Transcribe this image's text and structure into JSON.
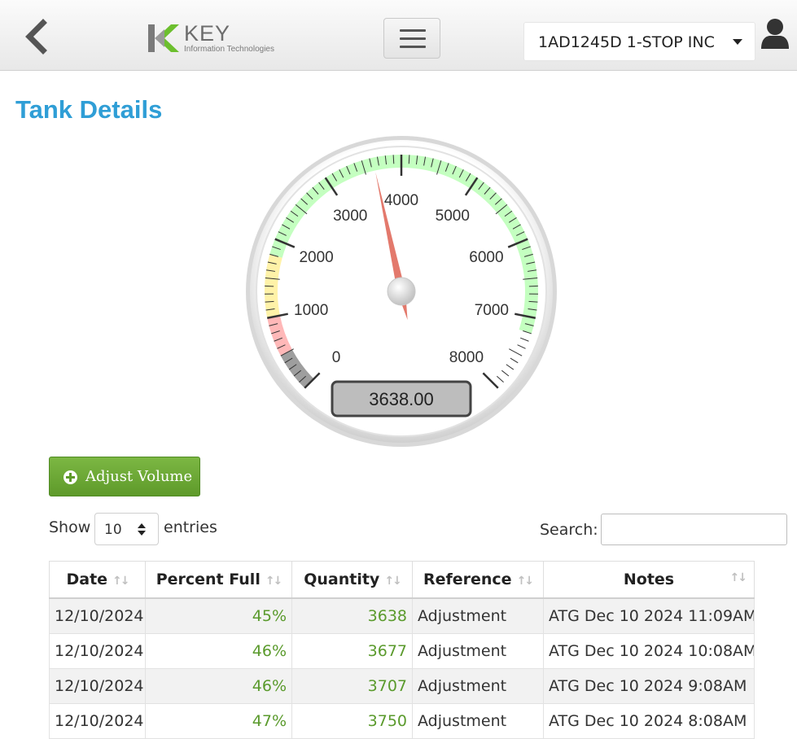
{
  "header": {
    "logo_text": "KEY",
    "logo_subtext": "Information Technologies",
    "site_selector": "1AD1245D 1-STOP INC",
    "back_icon": "chevron-left-icon",
    "menu_icon": "hamburger-icon",
    "user_icon": "user-icon"
  },
  "page": {
    "title": "Tank Details"
  },
  "gauge": {
    "min": 0,
    "max": 8000,
    "value": 3638,
    "display": "3638.00",
    "major_ticks": [
      "0",
      "1000",
      "2000",
      "3000",
      "4000",
      "5000",
      "6000",
      "7000",
      "8000"
    ],
    "bands": [
      {
        "from": 0,
        "to": 500,
        "color": "#9e9e9e"
      },
      {
        "from": 500,
        "to": 1000,
        "color": "#ffb8b8"
      },
      {
        "from": 1000,
        "to": 1800,
        "color": "#fff2a8"
      },
      {
        "from": 1800,
        "to": 7200,
        "color": "#c4ffc0"
      }
    ]
  },
  "actions": {
    "adjust_volume": "Adjust Volume",
    "adjust_icon": "plus-circle-icon"
  },
  "table_controls": {
    "show_label": "Show",
    "page_length": "10",
    "entries_label": "entries",
    "search_label": "Search:",
    "search_value": ""
  },
  "table": {
    "columns": [
      "Date",
      "Percent Full",
      "Quantity",
      "Reference",
      "Notes"
    ],
    "rows": [
      {
        "date": "12/10/2024",
        "percent": "45%",
        "quantity": "3638",
        "reference": "Adjustment",
        "notes": "ATG Dec 10 2024 11:09AM"
      },
      {
        "date": "12/10/2024",
        "percent": "46%",
        "quantity": "3677",
        "reference": "Adjustment",
        "notes": "ATG Dec 10 2024 10:08AM"
      },
      {
        "date": "12/10/2024",
        "percent": "46%",
        "quantity": "3707",
        "reference": "Adjustment",
        "notes": "ATG Dec 10 2024 9:08AM"
      },
      {
        "date": "12/10/2024",
        "percent": "47%",
        "quantity": "3750",
        "reference": "Adjustment",
        "notes": "ATG Dec 10 2024 8:08AM"
      }
    ]
  }
}
